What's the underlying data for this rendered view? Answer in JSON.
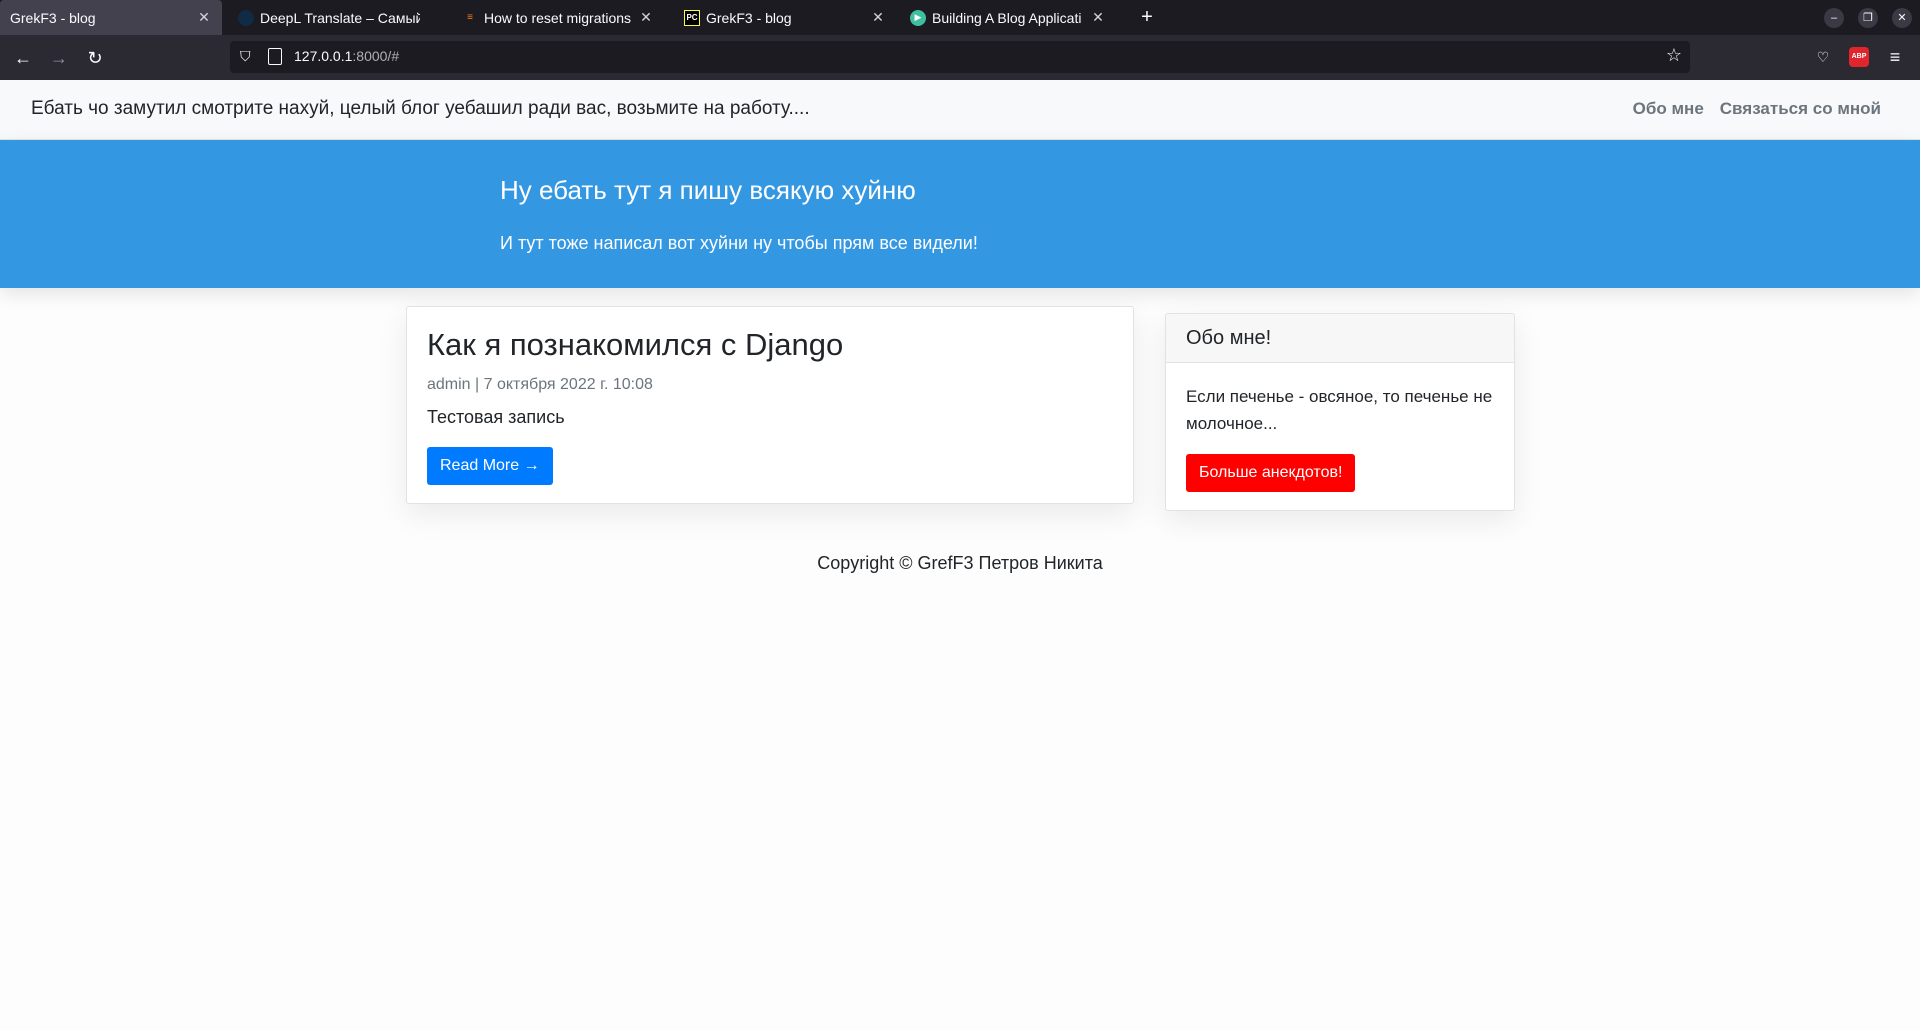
{
  "browser": {
    "tabs": [
      {
        "title": "GrekF3 - blog",
        "active": true
      },
      {
        "title": "DeepL Translate – Самый",
        "active": false
      },
      {
        "title": "How to reset migrations i",
        "active": false
      },
      {
        "title": "GrekF3 - blog",
        "active": false
      },
      {
        "title": "Building A Blog Applicati",
        "active": false
      }
    ],
    "url_host": "127.0.0.1",
    "url_rest": ":8000/#",
    "abp_label": "ABP"
  },
  "site": {
    "brand": "Ебать чо замутил смотрите нахуй, целый блог уебашил ради вас, возьмите на работу....",
    "nav": {
      "about": "Обо мне",
      "contact": "Связаться со мной"
    },
    "masthead": {
      "heading": "Ну ебать тут я пишу всякую хуйню",
      "subheading": "И тут тоже написал вот хуйни ну чтобы прям все видели!"
    },
    "post": {
      "title": "Как я познакомился с Django",
      "meta": "admin | 7 октября 2022 г. 10:08",
      "excerpt": "Тестовая запись",
      "read_more": "Read More →"
    },
    "sidebar": {
      "header": "Обо мне!",
      "body": "Если печенье - овсяное, то печенье не молочное...",
      "button": "Больше анекдотов!"
    },
    "footer": "Copyright © GrefF3 Петров Никита"
  }
}
